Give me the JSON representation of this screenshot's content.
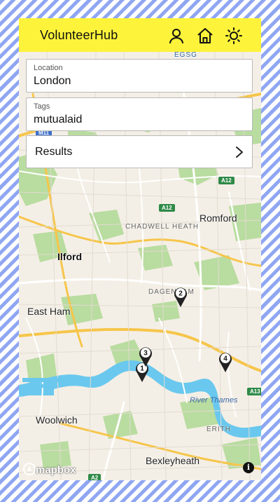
{
  "header": {
    "title": "VolunteerHub",
    "icons": [
      "user-icon",
      "home-icon",
      "sun-icon"
    ]
  },
  "form": {
    "location": {
      "label": "Location",
      "value": "London"
    },
    "tags": {
      "label": "Tags",
      "value": "mutualaid"
    },
    "results_label": "Results"
  },
  "map": {
    "places": {
      "romford": "Romford",
      "chadwell_heath": "CHADWELL HEATH",
      "ilford": "Ilford",
      "dagenham": "DAGENHAM",
      "east_ham": "East Ham",
      "river_thames": "River Thames",
      "woolwich": "Woolwich",
      "erith": "ERITH",
      "bexleyheath": "Bexleyheath"
    },
    "roads": {
      "a12_top": "A12",
      "a12_mid": "A12",
      "a13": "A13",
      "a2": "A2",
      "m11": "M11",
      "egsg": "EGSG"
    },
    "markers": [
      "1",
      "2",
      "3",
      "4"
    ],
    "attribution": "mapbox",
    "info_label": "i"
  },
  "colors": {
    "header_bg": "#fdf33a",
    "water": "#6ac8ee",
    "park": "#b9dca0",
    "land": "#f4efe6"
  }
}
